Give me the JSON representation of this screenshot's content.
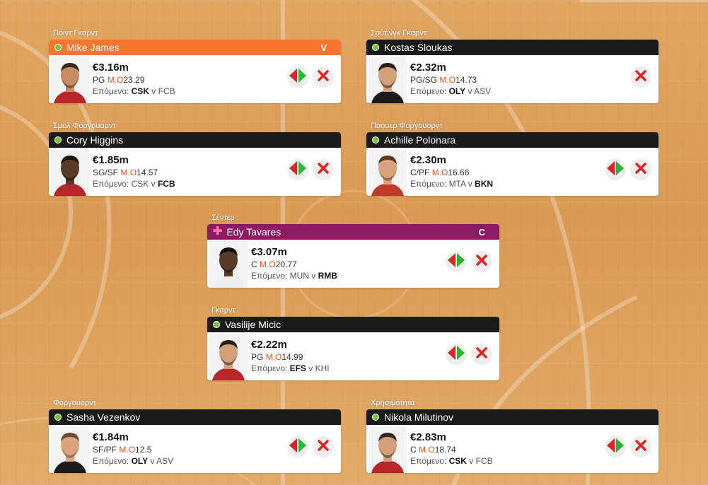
{
  "players": [
    {
      "position": "Πόιντ Γκαρντ",
      "name": "Mike James",
      "price": "€3.16m",
      "pos": "PG",
      "mo_label": "M.O",
      "mo": "23.29",
      "next_label": "Επόμενο:",
      "home": "CSK",
      "away": "FCB",
      "bold": "home",
      "status": "green",
      "badge": "V",
      "header": "orange",
      "has_swap": true,
      "skin": "#c98b63",
      "hair": "#3a2a20",
      "shirt": "#b8262a"
    },
    {
      "position": "Σούτινγκ Γκαρντ",
      "name": "Kostas Sloukas",
      "price": "€2.32m",
      "pos": "PG/SG",
      "mo_label": "M.O",
      "mo": "14.73",
      "next_label": "Επόμενο:",
      "home": "OLY",
      "away": "ASV",
      "bold": "home",
      "status": "green",
      "badge": "",
      "header": "dark",
      "has_swap": false,
      "skin": "#d4a07a",
      "hair": "#2a1e16",
      "shirt": "#1a1a1a"
    },
    {
      "position": "Σμολ Φόργουορντ",
      "name": "Cory Higgins",
      "price": "€1.85m",
      "pos": "SG/SF",
      "mo_label": "M.O",
      "mo": "14.57",
      "next_label": "Επόμενο:",
      "home": "CSK",
      "away": "FCB",
      "bold": "away",
      "status": "green",
      "badge": "",
      "header": "dark",
      "has_swap": true,
      "skin": "#5a3a28",
      "hair": "#1a120c",
      "shirt": "#b8262a"
    },
    {
      "position": "Πάουερ Φοργουορντ",
      "name": "Achille Polonara",
      "price": "€2.30m",
      "pos": "C/PF",
      "mo_label": "M.O",
      "mo": "16.66",
      "next_label": "Επόμενο:",
      "home": "MTA",
      "away": "BKN",
      "bold": "away",
      "status": "green",
      "badge": "",
      "header": "dark",
      "has_swap": true,
      "skin": "#d9a47e",
      "hair": "#5a3a22",
      "shirt": "#c0392b"
    },
    {
      "position": "Σέντερ",
      "name": "Edy Tavares",
      "price": "€3.07m",
      "pos": "C",
      "mo_label": "M.O",
      "mo": "20.77",
      "next_label": "Επόμενο:",
      "home": "MUN",
      "away": "RMB",
      "bold": "away",
      "status": "plus",
      "badge": "C",
      "header": "purple",
      "has_swap": true,
      "skin": "#5a3a28",
      "hair": "#1a120c",
      "shirt": "#eeeeee"
    },
    {
      "position": "Γκαρντ",
      "name": "Vasilije Micic",
      "price": "€2.22m",
      "pos": "PG",
      "mo_label": "M.O",
      "mo": "14.99",
      "next_label": "Επόμενο:",
      "home": "EFS",
      "away": "KHI",
      "bold": "home",
      "status": "green",
      "badge": "",
      "header": "dark",
      "has_swap": true,
      "skin": "#d4a07a",
      "hair": "#2a1e16",
      "shirt": "#b8262a"
    },
    {
      "position": "Φόργουορντ",
      "name": "Sasha Vezenkov",
      "price": "€1.84m",
      "pos": "SF/PF",
      "mo_label": "M.O",
      "mo": "12.5",
      "next_label": "Επόμενο:",
      "home": "OLY",
      "away": "ASV",
      "bold": "home",
      "status": "green",
      "badge": "",
      "header": "dark",
      "has_swap": true,
      "skin": "#d9a47e",
      "hair": "#6a4a30",
      "shirt": "#1a1a1a"
    },
    {
      "position": "Χρησιμότητα",
      "name": "Nikola Milutinov",
      "price": "€2.83m",
      "pos": "C",
      "mo_label": "M.O",
      "mo": "18.74",
      "next_label": "Επόμενο:",
      "home": "CSK",
      "away": "FCB",
      "bold": "home",
      "status": "green",
      "badge": "",
      "header": "dark",
      "has_swap": true,
      "skin": "#d4a07a",
      "hair": "#3a2a20",
      "shirt": "#b8262a"
    }
  ],
  "icons": {
    "swap": "swap-arrows-icon",
    "remove": "remove-x-icon",
    "status": "status-dot-icon"
  },
  "colors": {
    "accent_orange": "#f7762f",
    "captain_purple": "#8e1a62",
    "mo_red": "#e8541e",
    "status_green": "#7ac142",
    "remove_red": "#e02424"
  }
}
